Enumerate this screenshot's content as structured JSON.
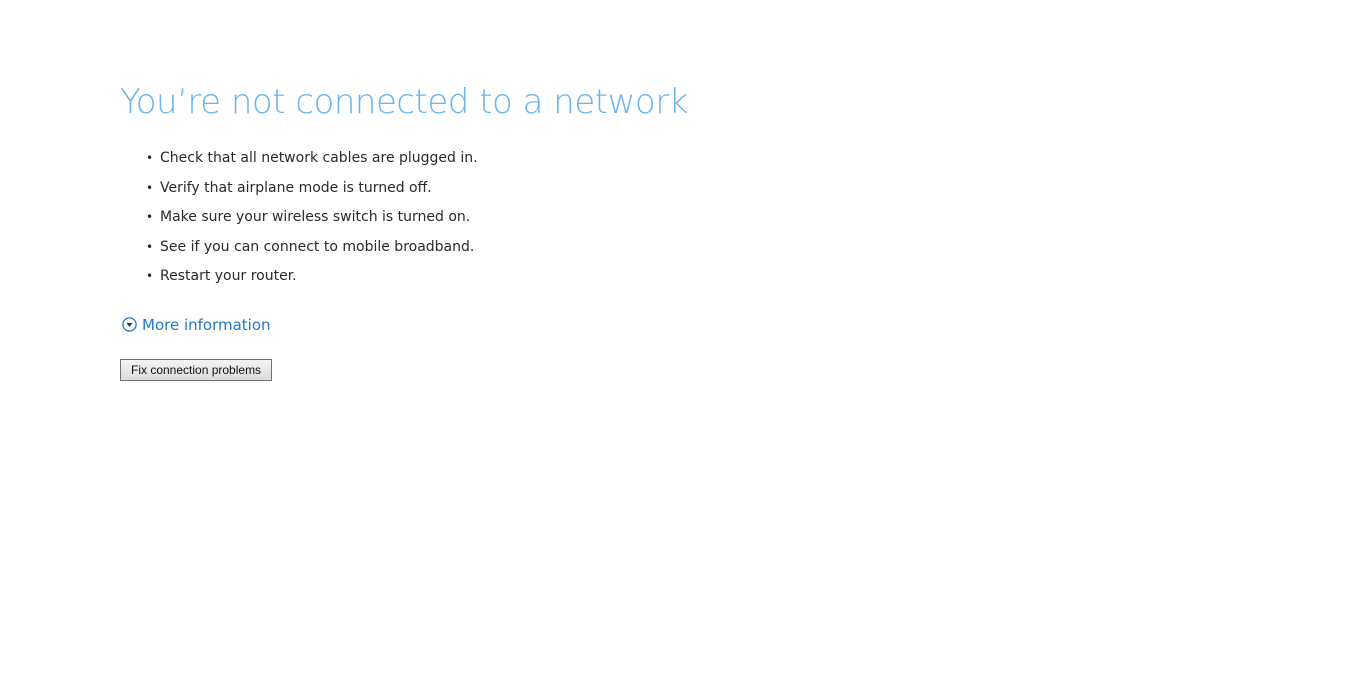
{
  "error": {
    "title": "You’re not connected to a network",
    "tips": [
      "Check that all network cables are plugged in.",
      "Verify that airplane mode is turned off.",
      "Make sure your wireless switch is turned on.",
      "See if you can connect to mobile broadband.",
      "Restart your router."
    ],
    "bullet": "•",
    "more_info_label": "More information",
    "more_info_icon": "chevron-down-circle-icon",
    "fix_button_label": "Fix connection problems"
  },
  "colors": {
    "title": "#6cb4ec",
    "link": "#2478c7",
    "text": "#2a2a2a",
    "background": "#ffffff"
  }
}
